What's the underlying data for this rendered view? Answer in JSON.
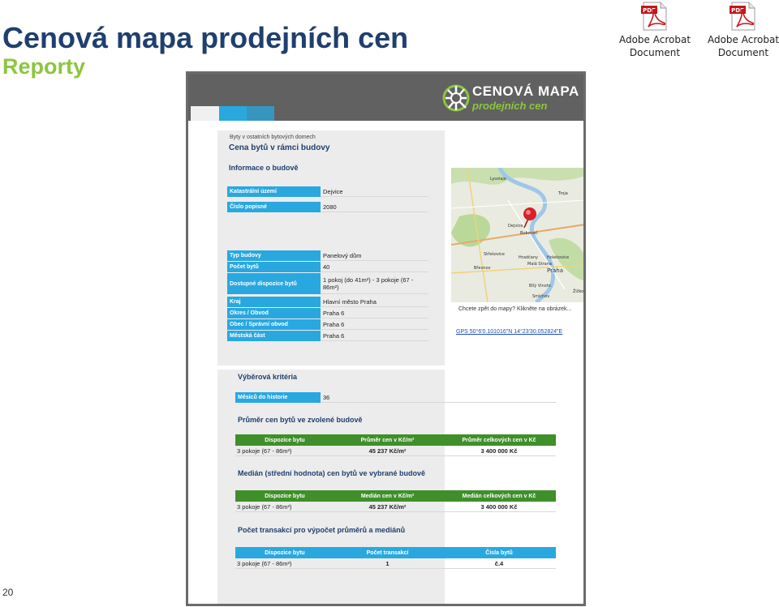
{
  "slide": {
    "title": "Cenová mapa prodejních cen",
    "subtitle": "Reporty",
    "page_number": "20"
  },
  "attachments": [
    {
      "icon": "pdf-icon",
      "label_line1": "Adobe Acrobat",
      "label_line2": "Document"
    },
    {
      "icon": "pdf-icon",
      "label_line1": "Adobe Acrobat",
      "label_line2": "Document"
    }
  ],
  "report": {
    "brand": "CENOVÁ MAPA",
    "brand_sub": "prodejních cen",
    "caption": "Byty v ostatních bytových domech",
    "title": "Cena bytů v rámci budovy",
    "info_title": "Informace o budově",
    "building": [
      {
        "label": "Katastrální území",
        "value": "Dejvice"
      },
      {
        "label": "Číslo popisné",
        "value": "2080"
      }
    ],
    "details": [
      {
        "label": "Typ budovy",
        "value": "Panelový dům"
      },
      {
        "label": "Počet bytů",
        "value": "40"
      },
      {
        "label": "Dostupné dispozice bytů",
        "value": "1 pokoj (do 41m²) - 3 pokoje (67 - 86m²)"
      },
      {
        "label": "Kraj",
        "value": "Hlavní město Praha"
      },
      {
        "label": "Okres / Obvod",
        "value": "Praha 6"
      },
      {
        "label": "Obec / Správní obvod",
        "value": "Praha 6"
      },
      {
        "label": "Městská část",
        "value": "Praha 6"
      }
    ],
    "map": {
      "labels": [
        "Lysolaje",
        "Troja",
        "Dejvice",
        "Bubeneč",
        "Střešovice",
        "Hradčany",
        "Holešovice",
        "Malá Strana",
        "Praha",
        "Břevnov",
        "Smíchov",
        "Žižkov",
        "Bílý Vinohr."
      ],
      "caption": "Chcete zpět do mapy? Klikněte na obrázek...",
      "gps": "GPS 50°6'0.101016\"N 14°23'30.052824\"E"
    },
    "criteria": {
      "title": "Výběrová kritéria",
      "label": "Měsíců do historie",
      "value": "36"
    },
    "avg": {
      "title": "Průměr cen bytů ve zvolené budově",
      "headers": [
        "Dispozice bytu",
        "Průměr cen v Kč/m²",
        "Průměr celkových cen v Kč"
      ],
      "row": [
        "3 pokoje (67 - 86m²)",
        "45 237 Kč/m²",
        "3 400 000 Kč"
      ]
    },
    "median": {
      "title": "Medián (střední hodnota) cen bytů ve vybrané budově",
      "headers": [
        "Dispozice bytu",
        "Medián cen v Kč/m²",
        "Medián celkových cen v Kč"
      ],
      "row": [
        "3 pokoje (67 - 86m²)",
        "45 237 Kč/m²",
        "3 400 000 Kč"
      ]
    },
    "count": {
      "title": "Počet transakcí pro výpočet průměrů a mediánů",
      "headers": [
        "Dispozice bytu",
        "Počet transakcí",
        "Čísla bytů"
      ],
      "row": [
        "3 pokoje (67 - 86m²)",
        "1",
        "č.4"
      ]
    }
  }
}
